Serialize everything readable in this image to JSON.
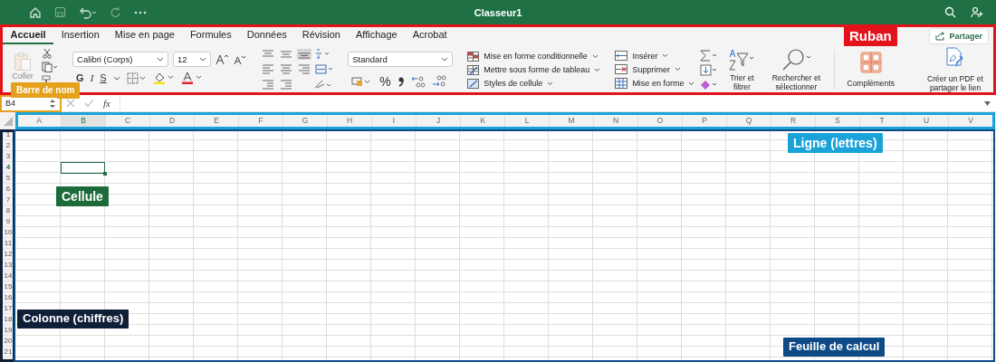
{
  "title_bar": {
    "title": "Classeur1"
  },
  "ribbon": {
    "tabs": [
      {
        "label": "Accueil",
        "selected": true
      },
      {
        "label": "Insertion",
        "selected": false
      },
      {
        "label": "Mise en page",
        "selected": false
      },
      {
        "label": "Formules",
        "selected": false
      },
      {
        "label": "Données",
        "selected": false
      },
      {
        "label": "Révision",
        "selected": false
      },
      {
        "label": "Affichage",
        "selected": false
      },
      {
        "label": "Acrobat",
        "selected": false
      }
    ],
    "share": "Partager",
    "clipboard": {
      "paste": "Coller"
    },
    "font": {
      "name": "Calibri (Corps)",
      "size": "12",
      "bold": "G",
      "italic": "I",
      "underline": "S"
    },
    "number": {
      "format": "Standard",
      "percent": "%"
    },
    "styles": [
      {
        "kind": "conditional",
        "label": "Mise en forme conditionnelle"
      },
      {
        "kind": "table",
        "label": "Mettre sous forme de tableau"
      },
      {
        "kind": "cell_styles",
        "label": "Styles de cellule"
      }
    ],
    "cells": [
      {
        "kind": "insert",
        "label": "Insérer"
      },
      {
        "kind": "delete",
        "label": "Supprimer"
      },
      {
        "kind": "format",
        "label": "Mise en forme"
      }
    ],
    "editing": {
      "sort": "Trier et filtrer",
      "find": "Rechercher et sélectionner"
    },
    "addins": "Compléments",
    "acrobat": "Créer un PDF et partager le lien"
  },
  "formula_bar": {
    "name_box": "B4",
    "function_label": "fx"
  },
  "sheet": {
    "columns": [
      {
        "label": "A",
        "selected": false
      },
      {
        "label": "B",
        "selected": true
      },
      {
        "label": "C",
        "selected": false
      },
      {
        "label": "D",
        "selected": false
      },
      {
        "label": "E",
        "selected": false
      },
      {
        "label": "F",
        "selected": false
      },
      {
        "label": "G",
        "selected": false
      },
      {
        "label": "H",
        "selected": false
      },
      {
        "label": "I",
        "selected": false
      },
      {
        "label": "J",
        "selected": false
      },
      {
        "label": "K",
        "selected": false
      },
      {
        "label": "L",
        "selected": false
      },
      {
        "label": "M",
        "selected": false
      },
      {
        "label": "N",
        "selected": false
      },
      {
        "label": "O",
        "selected": false
      },
      {
        "label": "P",
        "selected": false
      },
      {
        "label": "Q",
        "selected": false
      },
      {
        "label": "R",
        "selected": false
      },
      {
        "label": "S",
        "selected": false
      },
      {
        "label": "T",
        "selected": false
      },
      {
        "label": "U",
        "selected": false
      },
      {
        "label": "V",
        "selected": false
      }
    ],
    "rows": [
      {
        "label": "1",
        "selected": false
      },
      {
        "label": "2",
        "selected": false
      },
      {
        "label": "3",
        "selected": false
      },
      {
        "label": "4",
        "selected": true
      },
      {
        "label": "5",
        "selected": false
      },
      {
        "label": "6",
        "selected": false
      },
      {
        "label": "7",
        "selected": false
      },
      {
        "label": "8",
        "selected": false
      },
      {
        "label": "9",
        "selected": false
      },
      {
        "label": "10",
        "selected": false
      },
      {
        "label": "11",
        "selected": false
      },
      {
        "label": "12",
        "selected": false
      },
      {
        "label": "13",
        "selected": false
      },
      {
        "label": "14",
        "selected": false
      },
      {
        "label": "15",
        "selected": false
      },
      {
        "label": "16",
        "selected": false
      },
      {
        "label": "17",
        "selected": false
      },
      {
        "label": "18",
        "selected": false
      },
      {
        "label": "19",
        "selected": false
      },
      {
        "label": "20",
        "selected": false
      },
      {
        "label": "21",
        "selected": false
      }
    ]
  },
  "annotations": [
    {
      "kind": "ribbon",
      "label": "Ruban",
      "color": "#e3131b"
    },
    {
      "kind": "name_box",
      "label": "Barre de nom",
      "color": "#e4a11b"
    },
    {
      "kind": "column_headers",
      "label": "Ligne (lettres)",
      "color": "#1aa3d9"
    },
    {
      "kind": "cell",
      "label": "Cellule",
      "color": "#1d6b3a"
    },
    {
      "kind": "row_headers",
      "label": "Colonne (chiffres)",
      "color": "#101f38"
    },
    {
      "kind": "sheet",
      "label": "Feuille de calcul",
      "color": "#0d4a86"
    }
  ]
}
